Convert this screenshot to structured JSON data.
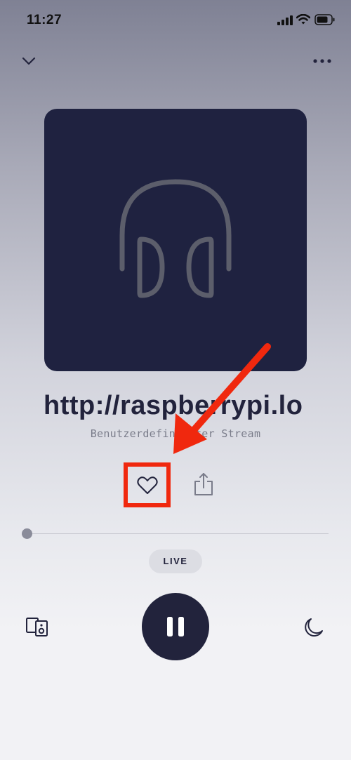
{
  "status_bar": {
    "time": "11:27",
    "icons": [
      "cellular-signal-icon",
      "wifi-icon",
      "battery-icon"
    ]
  },
  "header": {
    "collapse_icon": "chevron-down-icon",
    "more_icon": "more-horizontal-icon"
  },
  "artwork": {
    "icon": "headphones-icon",
    "background": "#1f2240",
    "icon_color": "#5c5e6b"
  },
  "now_playing": {
    "title": "http://raspberrypi.lo",
    "subtitle": "Benutzerdefinierter Stream"
  },
  "actions": {
    "favorite_icon": "heart-outline-icon",
    "share_icon": "share-icon"
  },
  "progress": {
    "position_fraction": 0.0
  },
  "live_badge": {
    "label": "LIVE"
  },
  "controls": {
    "speaker_icon": "speaker-devices-icon",
    "play_pause_icon": "pause-icon",
    "sleep_icon": "moon-icon"
  },
  "annotation": {
    "highlight_color": "#f0280e"
  },
  "colors": {
    "accent": "#22233c",
    "annotation": "#f0280e"
  }
}
